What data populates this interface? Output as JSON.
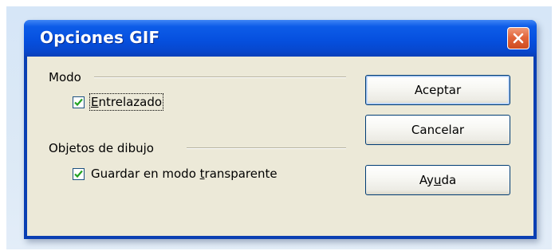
{
  "dialog": {
    "title": "Opciones GIF",
    "close_icon": "close-icon"
  },
  "groups": {
    "mode": {
      "label": "Modo",
      "interlaced": {
        "pre": "",
        "accel": "E",
        "post": "ntrelazado",
        "checked": true
      }
    },
    "drawing_objects": {
      "label": "Objetos de dibujo",
      "transparent": {
        "pre": "Guardar en modo ",
        "accel": "t",
        "post": "ransparente",
        "checked": true
      }
    }
  },
  "buttons": {
    "ok": "Aceptar",
    "cancel": "Cancelar",
    "help": {
      "pre": "Ay",
      "accel": "u",
      "post": "da"
    }
  },
  "colors": {
    "title_bar": "#0650df",
    "close_button": "#e2663c",
    "client_bg": "#ece9d8"
  }
}
